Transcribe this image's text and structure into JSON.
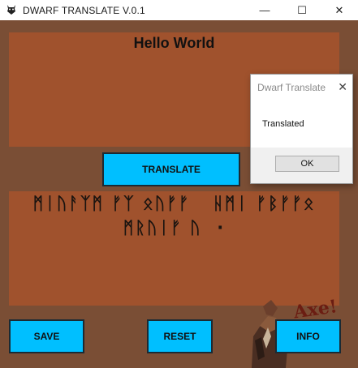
{
  "window": {
    "title": "DWARF TRANSLATE    V.0.1",
    "minimize": "—",
    "maximize": "☐",
    "close": "✕"
  },
  "input": {
    "text": "Hello World"
  },
  "output": {
    "runes_line1": "ᛗᛁᚢᚨᛉᛗ ᚠᛉ ᛟᚢᚠᚠ   ᚺᛗᛁ ᚠᛒᚠᚠᛟ",
    "runes_line2": "ᛗᚱᚢᛁᚠ ᚢ  ·"
  },
  "buttons": {
    "translate": "TRANSLATE",
    "save": "SAVE",
    "reset": "RESET",
    "info": "INFO"
  },
  "art": {
    "text": "Axe!"
  },
  "dialog": {
    "title": "Dwarf Translate",
    "close": "✕",
    "message": "Translated",
    "ok": "OK"
  },
  "colors": {
    "background": "#7a4e35",
    "panel": "#a0522d",
    "button": "#00bfff"
  }
}
